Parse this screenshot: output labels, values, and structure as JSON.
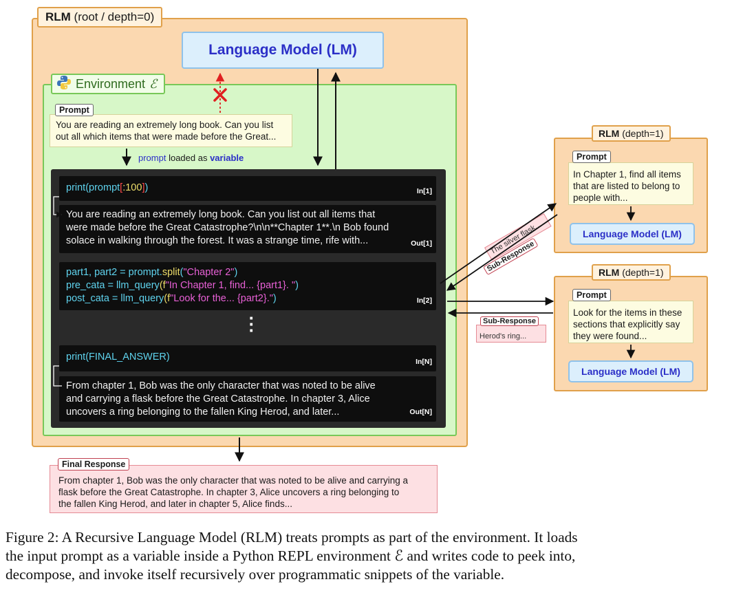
{
  "root": {
    "title_bold": "RLM",
    "title_rest": " (root / depth=0)"
  },
  "lm_main": {
    "label": "Language Model (LM)"
  },
  "environment": {
    "label": "Environment ",
    "symbol": "ℰ"
  },
  "prompt": {
    "tag": "Prompt",
    "line1": "You are reading an extremely long book. Can you list",
    "line2": "out all which items that were made before the Great..."
  },
  "loaded_note": {
    "var": "prompt",
    "mid": " loaded as ",
    "bold": "variable"
  },
  "repl": {
    "cell1": {
      "a": "print(prompt",
      "b": "[",
      "c": ":100",
      "d": "]",
      "e": ")",
      "label": "In[1]"
    },
    "out1": {
      "line1": "You are reading an extremely long book. Can you list out all items that",
      "line2": "were made before the Great Catastrophe?\\n\\n**Chapter 1**.\\n Bob found",
      "line3": "solace in walking through the forest. It was a strange time, rife with...",
      "label": "Out[1]"
    },
    "cell2": {
      "l1a": "part1, part2 = prompt.",
      "l1b": "split",
      "l1c": "(",
      "l1d": "\"Chapter 2\"",
      "l1e": ")",
      "l2a": "pre_cata = llm_query",
      "l2b": "(f",
      "l2c": "\"In Chapter 1, find... {part1}. \"",
      "l2d": ")",
      "l3a": "post_cata = llm_query",
      "l3b": "(f",
      "l3c": "\"Look for the... {part2}.\"",
      "l3d": ")",
      "label": "In[2]"
    },
    "cellN": {
      "a": "print(FINAL_ANSWER)",
      "label": "In[N]"
    },
    "outN": {
      "line1": "From chapter 1, Bob was the only character that was noted to be alive",
      "line2": "and carrying a flask before the Great Catastrophe. In chapter 3, Alice",
      "line3": "uncovers a ring belonging to the fallen King Herod, and later...",
      "label": "Out[N]"
    }
  },
  "sub1": {
    "tag_bold": "RLM",
    "tag_rest": " (depth=1)",
    "prompt_tag": "Prompt",
    "line1": "In Chapter 1, find all items",
    "line2": "that are listed to belong to",
    "line3": "people with...",
    "lm": "Language Model (LM)"
  },
  "sub2": {
    "tag_bold": "RLM",
    "tag_rest": " (depth=1)",
    "prompt_tag": "Prompt",
    "line1": "Look for the items in these",
    "line2": "sections that explicitly say",
    "line3": "they were found...",
    "lm": "Language Model (LM)"
  },
  "subresp1": {
    "tag": "Sub-Response",
    "text": "The silver flask..."
  },
  "subresp2": {
    "tag": "Sub-Response",
    "text": "Herod's ring..."
  },
  "final": {
    "tag": "Final Response",
    "line1": "From chapter 1, Bob was the only character that was noted to be alive and carrying a",
    "line2": "flask before the Great Catastrophe. In chapter 3, Alice uncovers a ring belonging to",
    "line3": "the fallen King Herod, and later in chapter 5, Alice finds..."
  },
  "caption": {
    "line1": "Figure 2: A Recursive Language Model (RLM) treats prompts as part of the environment. It loads",
    "line2": "the input prompt as a variable inside a Python REPL environment ℰ and writes code to peek into,",
    "line3": "decompose, and invoke itself recursively over programmatic snippets of the variable."
  },
  "colors": {
    "rlm_fill": "#fbd8b0",
    "rlm_border": "#e0a04a",
    "env_fill": "#d7f7c8",
    "env_border": "#78c858",
    "lm_fill": "#dceffc",
    "lm_text": "#2b2fc7",
    "prompt_fill": "#fdfce1",
    "response_fill": "#fde0e3",
    "repl_bg": "#0e0e0e",
    "x_mark": "#e02020"
  }
}
